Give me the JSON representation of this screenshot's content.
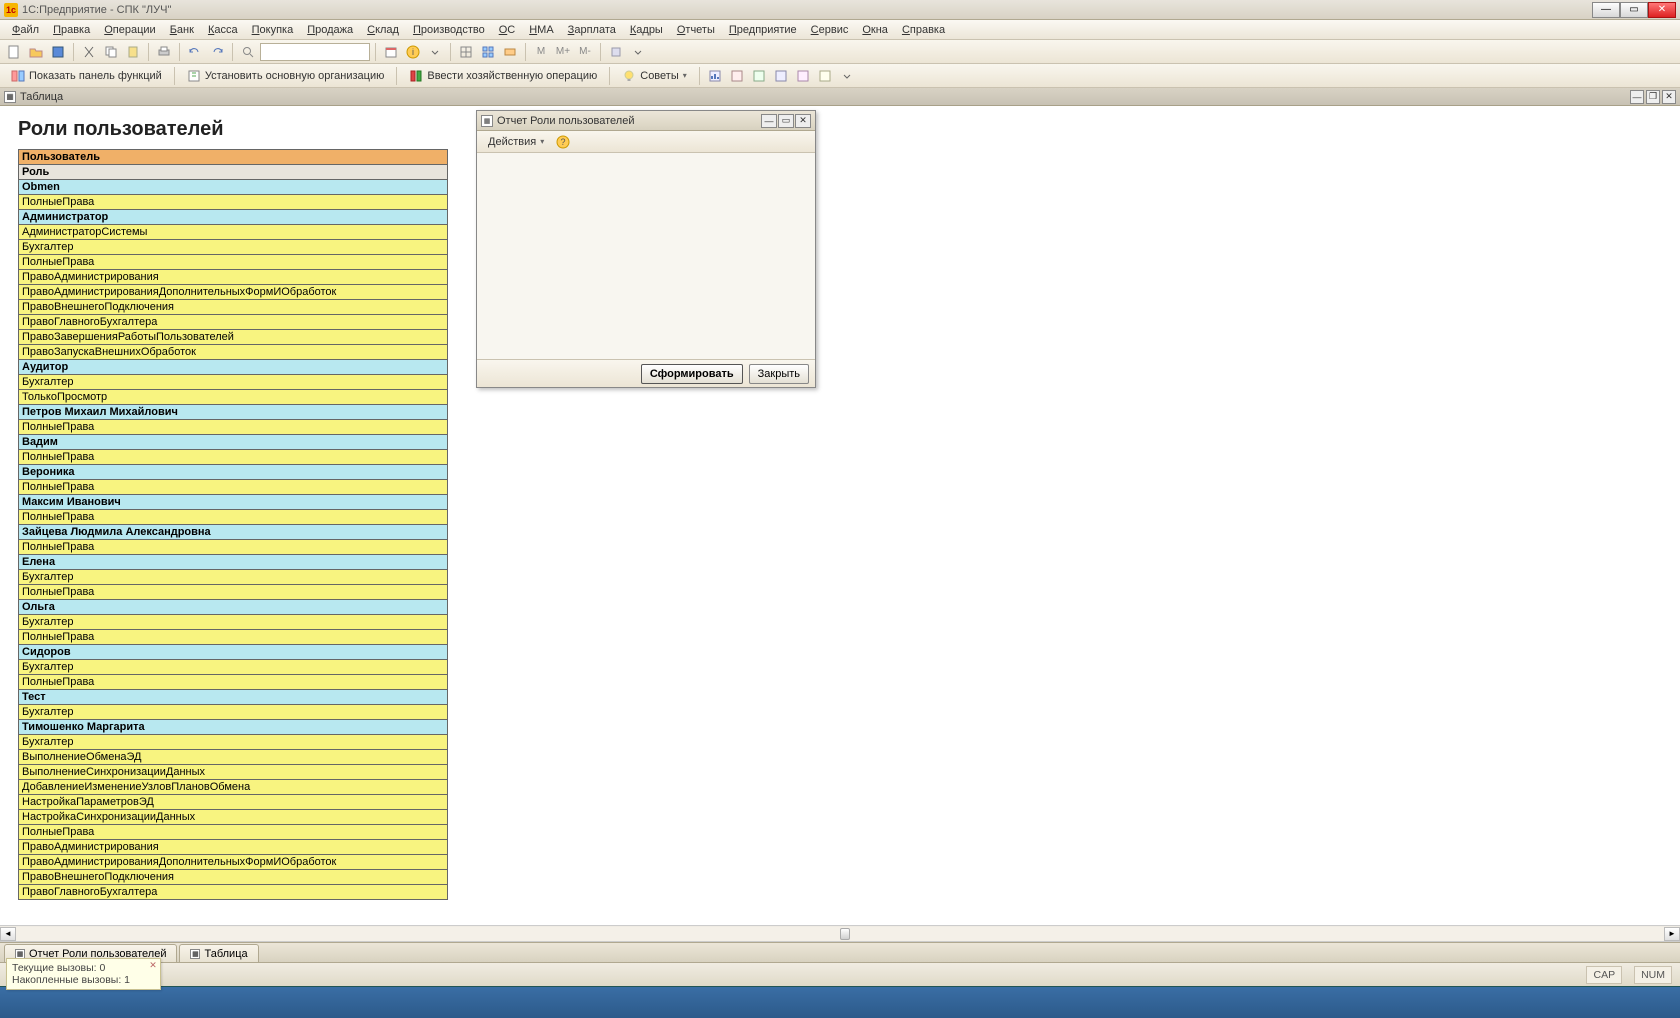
{
  "window": {
    "title": "1С:Предприятие - СПК \"ЛУЧ\""
  },
  "menu": {
    "items": [
      "Файл",
      "Правка",
      "Операции",
      "Банк",
      "Касса",
      "Покупка",
      "Продажа",
      "Склад",
      "Производство",
      "ОС",
      "НМА",
      "Зарплата",
      "Кадры",
      "Отчеты",
      "Предприятие",
      "Сервис",
      "Окна",
      "Справка"
    ]
  },
  "toolbar2": {
    "show_panel": "Показать панель функций",
    "set_org": "Установить основную организацию",
    "enter_op": "Ввести хозяйственную операцию",
    "tips": "Советы"
  },
  "subwin": {
    "tab_label": "Таблица"
  },
  "page": {
    "title": "Роли пользователей"
  },
  "headers": {
    "user": "Пользователь",
    "role": "Роль"
  },
  "groups": [
    {
      "user": "Obmen",
      "roles": [
        "ПолныеПрава"
      ]
    },
    {
      "user": "Администратор",
      "roles": [
        "АдминистраторСистемы",
        "Бухгалтер",
        "ПолныеПрава",
        "ПравоАдминистрирования",
        "ПравоАдминистрированияДополнительныхФормИОбработок",
        "ПравоВнешнегоПодключения",
        "ПравоГлавногоБухгалтера",
        "ПравоЗавершенияРаботыПользователей",
        "ПравоЗапускаВнешнихОбработок"
      ]
    },
    {
      "user": "Аудитор",
      "roles": [
        "Бухгалтер",
        "ТолькоПросмотр"
      ]
    },
    {
      "user": "Петров Михаил Михайлович",
      "roles": [
        "ПолныеПрава"
      ]
    },
    {
      "user": "Вадим",
      "roles": [
        "ПолныеПрава"
      ]
    },
    {
      "user": "Вероника",
      "roles": [
        "ПолныеПрава"
      ]
    },
    {
      "user": "Максим Иванович",
      "roles": [
        "ПолныеПрава"
      ]
    },
    {
      "user": "Зайцева Людмила Александровна",
      "roles": [
        "ПолныеПрава"
      ]
    },
    {
      "user": "Елена",
      "roles": [
        "Бухгалтер",
        "ПолныеПрава"
      ]
    },
    {
      "user": "Ольга",
      "roles": [
        "Бухгалтер",
        "ПолныеПрава"
      ]
    },
    {
      "user": "Сидоров",
      "roles": [
        "Бухгалтер",
        "ПолныеПрава"
      ]
    },
    {
      "user": "Тест",
      "roles": [
        "Бухгалтер"
      ]
    },
    {
      "user": "Тимошенко Маргарита",
      "roles": [
        "Бухгалтер",
        "ВыполнениеОбменаЭД",
        "ВыполнениеСинхронизацииДанных",
        "ДобавлениеИзменениеУзловПлановОбмена",
        "НастройкаПараметровЭД",
        "НастройкаСинхронизацииДанных",
        "ПолныеПрава",
        "ПравоАдминистрирования",
        "ПравоАдминистрированияДополнительныхФормИОбработок",
        "ПравоВнешнегоПодключения",
        "ПравоГлавногоБухгалтера"
      ]
    }
  ],
  "popup": {
    "title": "Отчет  Роли пользователей",
    "actions": "Действия",
    "generate": "Сформировать",
    "close": "Закрыть"
  },
  "bottom_tabs": {
    "tab1": "Отчет  Роли пользователей",
    "tab2": "Таблица"
  },
  "call_box": {
    "line1": "Текущие вызовы: 0",
    "line2": "Накопленные вызовы: 1"
  },
  "status": {
    "cap": "CAP",
    "num": "NUM"
  },
  "toolbar1_labels": {
    "m": "M",
    "mplus": "M+",
    "mminus": "M-"
  }
}
